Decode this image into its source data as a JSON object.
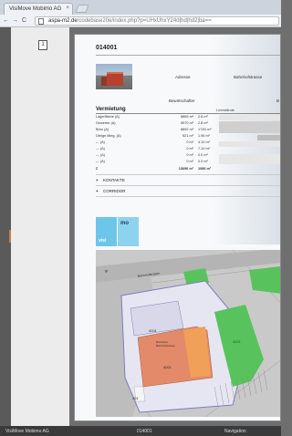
{
  "browser": {
    "tab_title": "VisiMove Mobimo AG",
    "tab_close": "×",
    "nav_back": "←",
    "nav_forward": "→",
    "nav_reload": "C",
    "url_host": "aspa-m2.de",
    "url_path": "/codebase20e/index.php?p=UHxUhxY24d|hd|hd2|ba=="
  },
  "sidebar": {
    "page_icon_label": "1"
  },
  "page": {
    "title": "014001",
    "info": {
      "adresse_label": "Adresse",
      "adresse_value": "Bahnhofstrasse",
      "eigentuemer_label": "Bewirtschafter",
      "eigentuemer_value": "B"
    },
    "usage": {
      "title": "Vermietung",
      "subtitle": "Leerstände",
      "rows": [
        {
          "name": "Lagerfläche (A)",
          "area": "8865 m²",
          "rate": "2.8 m²"
        },
        {
          "name": "Gewerbe (A)",
          "area": "5970 m²",
          "rate": "2.8 m²"
        },
        {
          "name": "Büro (A)",
          "area": "8892 m²",
          "rate": "1'191 m²"
        },
        {
          "name": "Übrige Mieg. (A)",
          "area": "521 m²",
          "rate": "1.96 m²"
        },
        {
          "name": "--- (A)",
          "area": "0 m²",
          "rate": "4.10 m²"
        },
        {
          "name": "--- (A)",
          "area": "0 m²",
          "rate": "7.10 m²"
        },
        {
          "name": "--- (A)",
          "area": "0 m²",
          "rate": "0.0 m²"
        },
        {
          "name": "--- (A)",
          "area": "0 m²",
          "rate": "0.0 m²"
        }
      ],
      "total": {
        "name": "Σ",
        "area": "13696 m²",
        "rate": "1086 m²"
      }
    },
    "sections": [
      {
        "symbol": "+",
        "label": "KONTAKTE"
      },
      {
        "symbol": "+",
        "label": "CORRIDOR"
      }
    ],
    "logo": {
      "top_text": "mo",
      "bottom_text": "visi"
    },
    "map": {
      "label_upper_left": "gr",
      "label_green": "4001",
      "label_central": "4001",
      "label_main": "4001",
      "label_lower_left": "401",
      "building_text_line1": "Bürohaus",
      "building_text_line2": "Bahnhofstrasse",
      "street_label": "Bahnhofstrasse"
    }
  },
  "statusbar": {
    "left": "VisiMove Mobimo AG",
    "center": "014001",
    "right": "Navigation"
  }
}
